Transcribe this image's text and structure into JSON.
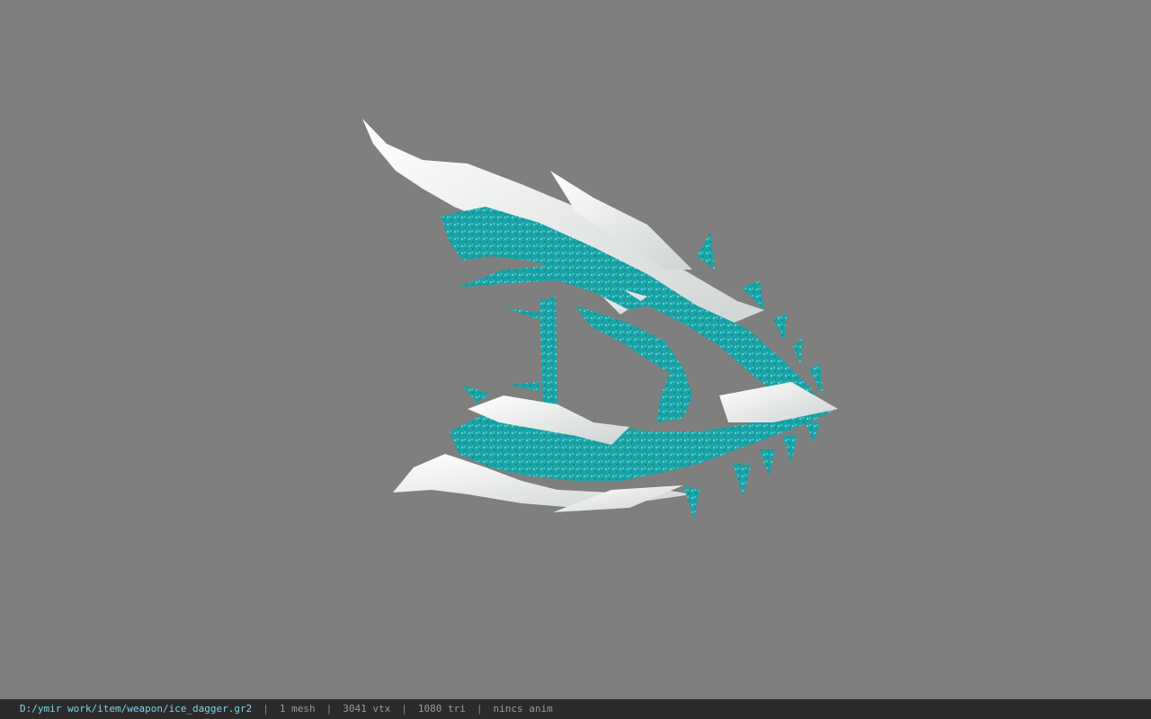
{
  "viewer": {
    "background_color": "#7f7f7f",
    "model_primary_color": "#1aa3a6",
    "model_highlight_color": "#f2f2f2"
  },
  "status": {
    "file_path": "D:/ymir work/item/weapon/ice_dagger.gr2",
    "separator": "|",
    "mesh": "1 mesh",
    "vertices": "3041 vtx",
    "triangles": "1080 tri",
    "anim": "nincs anim"
  }
}
